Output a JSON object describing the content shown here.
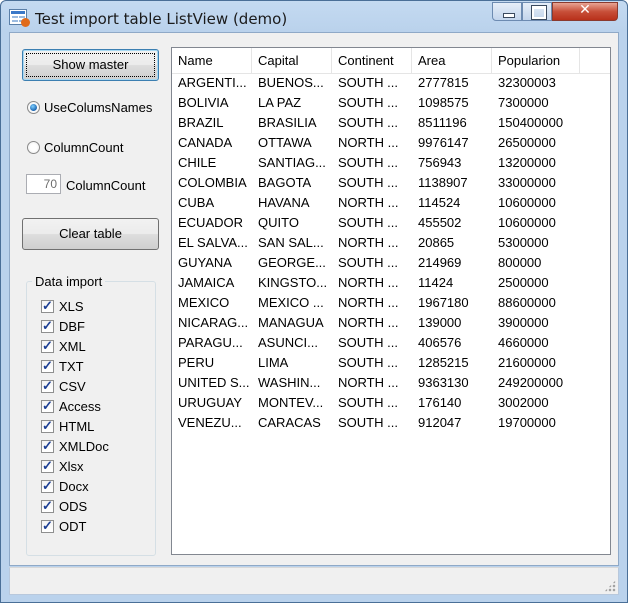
{
  "window": {
    "title": "Test import table ListView (demo)",
    "close_glyph": "✕"
  },
  "left_panel": {
    "show_master_label": "Show master",
    "radio_use_names_label": "UseColumsNames",
    "radio_use_names_checked": true,
    "radio_column_count_label": "ColumnCount",
    "radio_column_count_checked": false,
    "column_count_value": "70",
    "column_count_label": "ColumnCount",
    "clear_table_label": "Clear table"
  },
  "data_import": {
    "title": "Data import",
    "items": [
      {
        "label": "XLS",
        "checked": true
      },
      {
        "label": "DBF",
        "checked": true
      },
      {
        "label": "XML",
        "checked": true
      },
      {
        "label": "TXT",
        "checked": true
      },
      {
        "label": "CSV",
        "checked": true
      },
      {
        "label": "Access",
        "checked": true
      },
      {
        "label": "HTML",
        "checked": true
      },
      {
        "label": "XMLDoc",
        "checked": true
      },
      {
        "label": "Xlsx",
        "checked": true
      },
      {
        "label": "Docx",
        "checked": true
      },
      {
        "label": "ODS",
        "checked": true
      },
      {
        "label": "ODT",
        "checked": true
      }
    ]
  },
  "table": {
    "columns": [
      "Name",
      "Capital",
      "Continent",
      "Area",
      "Popularion"
    ],
    "rows": [
      [
        "ARGENTI...",
        "BUENOS...",
        "SOUTH ...",
        "2777815",
        "32300003"
      ],
      [
        "BOLIVIA",
        "LA PAZ",
        "SOUTH ...",
        "1098575",
        "7300000"
      ],
      [
        "BRAZIL",
        "BRASILIA",
        "SOUTH ...",
        "8511196",
        "150400000"
      ],
      [
        "CANADA",
        "OTTAWA",
        "NORTH ...",
        "9976147",
        "26500000"
      ],
      [
        "CHILE",
        "SANTIAG...",
        "SOUTH ...",
        "756943",
        "13200000"
      ],
      [
        "COLOMBIA",
        "BAGOTA",
        "SOUTH ...",
        "1138907",
        "33000000"
      ],
      [
        "CUBA",
        "HAVANA",
        "NORTH ...",
        "114524",
        "10600000"
      ],
      [
        "ECUADOR",
        "QUITO",
        "SOUTH ...",
        "455502",
        "10600000"
      ],
      [
        "EL SALVA...",
        "SAN SAL...",
        "NORTH ...",
        "20865",
        "5300000"
      ],
      [
        "GUYANA",
        "GEORGE...",
        "SOUTH ...",
        "214969",
        "800000"
      ],
      [
        "JAMAICA",
        "KINGSTO...",
        "NORTH ...",
        "11424",
        "2500000"
      ],
      [
        "MEXICO",
        "MEXICO ...",
        "NORTH ...",
        "1967180",
        "88600000"
      ],
      [
        "NICARAG...",
        "MANAGUA",
        "NORTH ...",
        "139000",
        "3900000"
      ],
      [
        "PARAGU...",
        "ASUNCI...",
        "SOUTH ...",
        "406576",
        "4660000"
      ],
      [
        "PERU",
        "LIMA",
        "SOUTH ...",
        "1285215",
        "21600000"
      ],
      [
        "UNITED S...",
        "WASHIN...",
        "NORTH ...",
        "9363130",
        "249200000"
      ],
      [
        "URUGUAY",
        "MONTEV...",
        "SOUTH ...",
        "176140",
        "3002000"
      ],
      [
        "VENEZU...",
        "CARACAS",
        "SOUTH ...",
        "912047",
        "19700000"
      ]
    ]
  }
}
